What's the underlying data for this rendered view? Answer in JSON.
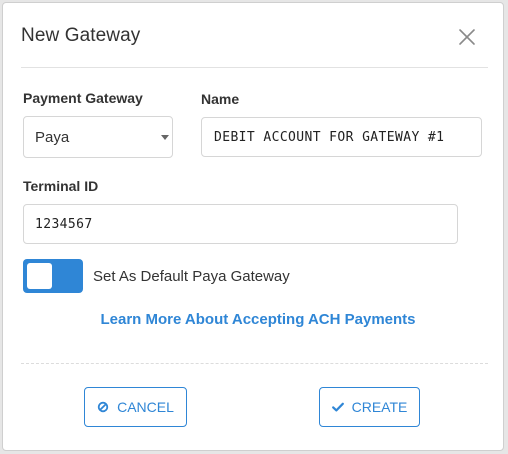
{
  "dialog": {
    "title": "New Gateway"
  },
  "form": {
    "payment_gateway_label": "Payment Gateway",
    "payment_gateway_value": "Paya",
    "name_label": "Name",
    "name_value": "DEBIT ACCOUNT FOR GATEWAY #1",
    "terminal_id_label": "Terminal ID",
    "terminal_id_value": "1234567",
    "default_toggle_label": "Set As Default Paya Gateway",
    "default_toggle_on": true
  },
  "links": {
    "learn_more": "Learn More About Accepting ACH Payments"
  },
  "buttons": {
    "cancel_label": "CANCEL",
    "create_label": "CREATE"
  },
  "icons": {
    "close": "close-icon",
    "cancel": "ban-icon",
    "create": "check-icon",
    "select_caret": "caret-down-icon"
  },
  "colors": {
    "accent": "#2f86d6",
    "text": "#333333",
    "border": "#d6d6d6"
  }
}
